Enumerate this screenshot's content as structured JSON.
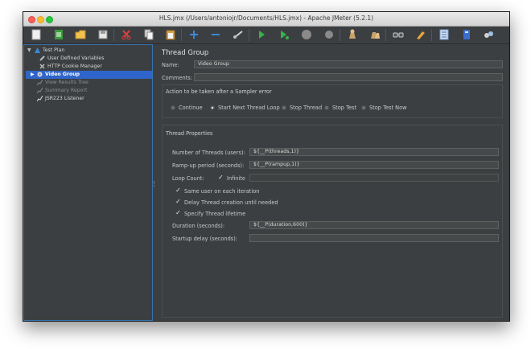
{
  "window": {
    "title": "HLS.jmx (/Users/antoniojr/Documents/HLS.jmx) - Apache JMeter (5.2.1)"
  },
  "toolbar": {
    "buttons": [
      "new",
      "templates",
      "open",
      "save",
      "cut",
      "copy",
      "paste",
      "expand",
      "collapse",
      "toggle",
      "start",
      "start-no-timers",
      "stop",
      "shutdown",
      "clear",
      "clear-all",
      "search",
      "reset-search",
      "function-helper",
      "help",
      "remote"
    ]
  },
  "tree": {
    "items": [
      {
        "label": "Test Plan",
        "icon": "test-plan-icon",
        "state": "normal"
      },
      {
        "label": "User Defined Variables",
        "icon": "wrench-icon",
        "state": "normal"
      },
      {
        "label": "HTTP Cookie Manager",
        "icon": "wrench-icon",
        "state": "normal"
      },
      {
        "label": "Video Group",
        "icon": "gear-icon",
        "state": "selected"
      },
      {
        "label": "View Results Tree",
        "icon": "graph-icon",
        "state": "disabled"
      },
      {
        "label": "Summary Report",
        "icon": "graph-icon",
        "state": "disabled"
      },
      {
        "label": "JSR223 Listener",
        "icon": "graph-icon",
        "state": "normal"
      }
    ]
  },
  "main": {
    "header": "Thread Group",
    "name_label": "Name:",
    "name_value": "Video Group",
    "comments_label": "Comments:",
    "comments_value": "",
    "error_action": {
      "title": "Action to be taken after a Sampler error",
      "options": [
        "Continue",
        "Start Next Thread Loop",
        "Stop Thread",
        "Stop Test",
        "Stop Test Now"
      ],
      "selected": "Start Next Thread Loop"
    },
    "thread_properties": {
      "title": "Thread Properties",
      "threads_label": "Number of Threads (users):",
      "threads_value": "${__P(threads,1)}",
      "rampup_label": "Ramp-up period (seconds):",
      "rampup_value": "${__P(rampup,1)}",
      "loop_label": "Loop Count:",
      "infinite_label": "Infinite",
      "infinite_checked": true,
      "loop_value": "",
      "same_user_label": "Same user on each iteration",
      "delay_label": "Delay Thread creation until needed",
      "lifetime_label": "Specify Thread lifetime",
      "duration_label": "Duration (seconds):",
      "duration_value": "${__P(duration,600)}",
      "startup_label": "Startup delay (seconds):",
      "startup_value": ""
    }
  },
  "colors": {
    "selection": "#2f65ca",
    "background": "#3c3f41",
    "field": "#45494a"
  }
}
